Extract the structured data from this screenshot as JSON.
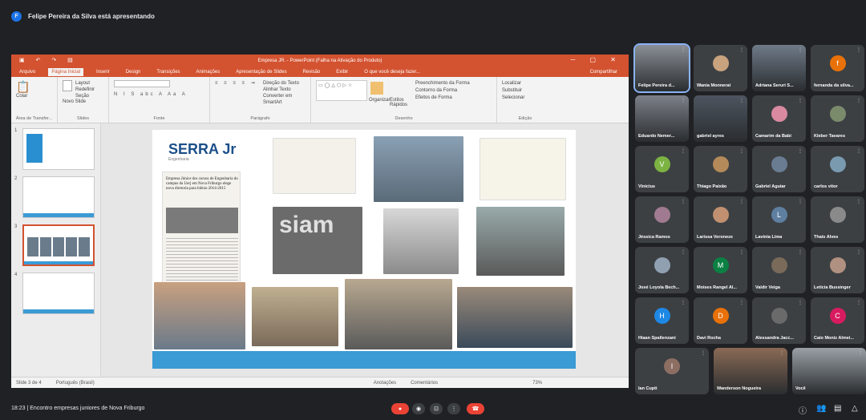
{
  "presenter": {
    "initial": "F",
    "text": "Felipe Pereira da Silva está apresentando"
  },
  "ppt": {
    "title": "Empresa JR. - PowerPoint (Falha na Ativação do Produto)",
    "tabs": [
      "Arquivo",
      "Página Inicial",
      "Inserir",
      "Design",
      "Transições",
      "Animações",
      "Apresentação de Slides",
      "Revisão",
      "Exibir",
      "O que você deseja fazer..."
    ],
    "share": "Compartilhar",
    "groups": [
      "Área de Transfer...",
      "Slides",
      "Fonte",
      "Parágrafo",
      "Desenho",
      "Edição"
    ],
    "ribbon_items": {
      "paste": "Colar",
      "new_slide": "Novo Slide",
      "layout": "Layout",
      "reset": "Redefinir",
      "section": "Seção",
      "organize": "Organizar",
      "styles": "Estilos Rápidos",
      "find": "Localizar",
      "replace": "Substituir",
      "select": "Selecionar",
      "text_dir": "Direção do Texto",
      "align": "Alinhar Texto",
      "convert": "Converter em SmartArt",
      "fill": "Preenchimento da Forma",
      "outline": "Contorno da Forma",
      "effects": "Efeitos de Forma"
    },
    "status": {
      "slide": "Slide 3 de 4",
      "lang": "Português (Brasil)",
      "notes": "Anotações",
      "comments": "Comentários",
      "zoom": "73%"
    },
    "slide_nums": [
      "1",
      "2",
      "3",
      "4"
    ],
    "logo": "SERRA Jr",
    "logo_sub": "Engenharia",
    "newspaper_head": "Empresa Júnior dos cursos de Engenharia do campus da Uerj em Nova Friburgo elege nova diretoria para biênio 2014-2015",
    "siam_text": "siam"
  },
  "participants": [
    {
      "name": "Felipe Pereira d...",
      "type": "video",
      "color": "#8a8f96"
    },
    {
      "name": "Wania Monnerat",
      "type": "avatar-photo",
      "color": "#c9a27e"
    },
    {
      "name": "Adriana Seruri S...",
      "type": "video",
      "color": "#6f7a88"
    },
    {
      "name": "fernanda da silva...",
      "type": "letter",
      "letter": "f",
      "color": "#e8710a"
    },
    {
      "name": "Eduardo Nemer...",
      "type": "video",
      "color": "#7c8088"
    },
    {
      "name": "gabriel ayres",
      "type": "video",
      "color": "#4d5560"
    },
    {
      "name": "Camarim da Babi",
      "type": "avatar-photo",
      "color": "#d98aa0"
    },
    {
      "name": "Kleber Tavares",
      "type": "avatar-photo",
      "color": "#7a8b6c"
    },
    {
      "name": "Vinicius",
      "type": "letter",
      "letter": "V",
      "color": "#7cb342"
    },
    {
      "name": "Thiago Paixão",
      "type": "avatar-photo",
      "color": "#b48a5a"
    },
    {
      "name": "Gabriel Aguiar",
      "type": "avatar-photo",
      "color": "#6a7c92"
    },
    {
      "name": "carlos vitor",
      "type": "avatar-photo",
      "color": "#7a9ab0"
    },
    {
      "name": "Jéssica Ramos",
      "type": "avatar-photo",
      "color": "#a07a90"
    },
    {
      "name": "Larissa Veroneze",
      "type": "avatar-photo",
      "color": "#c09070"
    },
    {
      "name": "Lavínia Lima",
      "type": "letter",
      "letter": "L",
      "color": "#5f7fa0"
    },
    {
      "name": "Thaís Alves",
      "type": "avatar-photo",
      "color": "#8a8a8a"
    },
    {
      "name": "José Loyola Bech...",
      "type": "avatar-photo",
      "color": "#90a0b0"
    },
    {
      "name": "Moises Rangel Al...",
      "type": "letter",
      "letter": "M",
      "color": "#0b8043"
    },
    {
      "name": "Valdir Veiga",
      "type": "avatar-photo",
      "color": "#7a6a5a"
    },
    {
      "name": "Letícia Bussinger",
      "type": "avatar-photo",
      "color": "#b09080"
    },
    {
      "name": "Hiaan Spallenzani",
      "type": "letter",
      "letter": "H",
      "color": "#1e88e5"
    },
    {
      "name": "Davi Rocha",
      "type": "letter",
      "letter": "D",
      "color": "#e8710a"
    },
    {
      "name": "Alessandra Jacc...",
      "type": "avatar-photo",
      "color": "#6a6a6a"
    },
    {
      "name": "Caio Moniz Almei...",
      "type": "letter",
      "letter": "C",
      "color": "#d81b60"
    },
    {
      "name": "Ian Cupti",
      "type": "letter",
      "letter": "I",
      "color": "#8d6e63"
    },
    {
      "name": "Wanderson Nogueira",
      "type": "video",
      "color": "#8a6a55"
    },
    {
      "name": "Você",
      "type": "video",
      "color": "#9aa0a6"
    }
  ],
  "meeting": {
    "time": "18:23",
    "sep": "|",
    "name": "Encontro empresas juniores de Nova Friburgo"
  },
  "controls": {
    "mic": "mic-icon",
    "cam": "camera-icon",
    "present": "present-icon",
    "more": "more-icon",
    "hangup": "hangup-icon"
  },
  "right_controls": [
    "info-icon",
    "people-icon",
    "chat-icon",
    "activities-icon"
  ]
}
